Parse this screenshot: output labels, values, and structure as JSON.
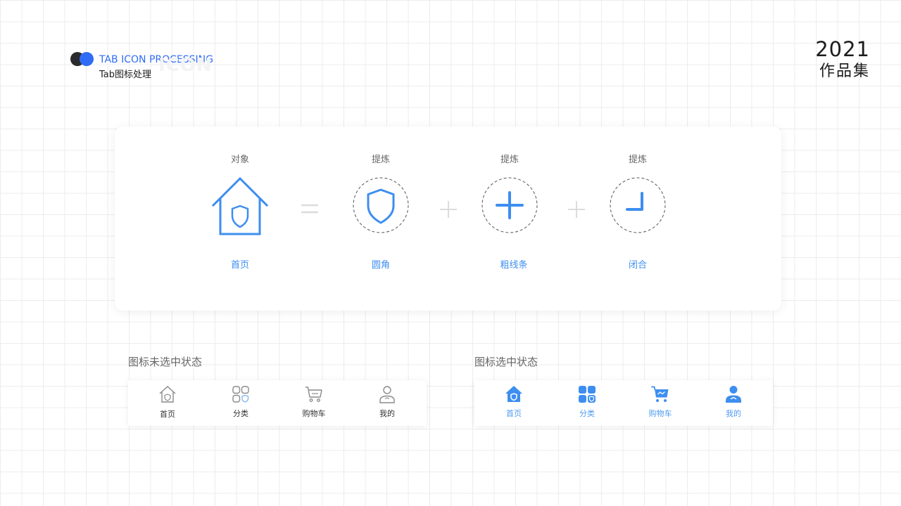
{
  "header": {
    "title_en": "TAB ICON PROCESSING",
    "title_zh": "Tab图标处理",
    "watermark": "ICON"
  },
  "year": {
    "number": "2021",
    "label": "作品集"
  },
  "breakdown": {
    "columns": [
      {
        "top_label": "对象",
        "bottom_label": "首页",
        "icon": "house-shield-icon"
      },
      {
        "top_label": "提炼",
        "bottom_label": "圆角",
        "icon": "shield-icon"
      },
      {
        "top_label": "提炼",
        "bottom_label": "粗线条",
        "icon": "plus-icon"
      },
      {
        "top_label": "提炼",
        "bottom_label": "闭合",
        "icon": "corner-icon"
      }
    ],
    "operators": [
      "=",
      "+",
      "+"
    ]
  },
  "unselected": {
    "title": "图标未选中状态",
    "tabs": [
      {
        "label": "首页",
        "icon": "home-icon"
      },
      {
        "label": "分类",
        "icon": "category-icon"
      },
      {
        "label": "购物车",
        "icon": "cart-icon"
      },
      {
        "label": "我的",
        "icon": "user-icon"
      }
    ]
  },
  "selected": {
    "title": "图标选中状态",
    "tabs": [
      {
        "label": "首页",
        "icon": "home-icon"
      },
      {
        "label": "分类",
        "icon": "category-icon"
      },
      {
        "label": "购物车",
        "icon": "cart-icon"
      },
      {
        "label": "我的",
        "icon": "user-icon"
      }
    ]
  },
  "colors": {
    "accent": "#3d8ef0",
    "brand_blue": "#2f6cf5",
    "dark": "#2b2b2d",
    "icon_gray": "#8a8a8a",
    "operator_gray": "#dcdcdc"
  }
}
